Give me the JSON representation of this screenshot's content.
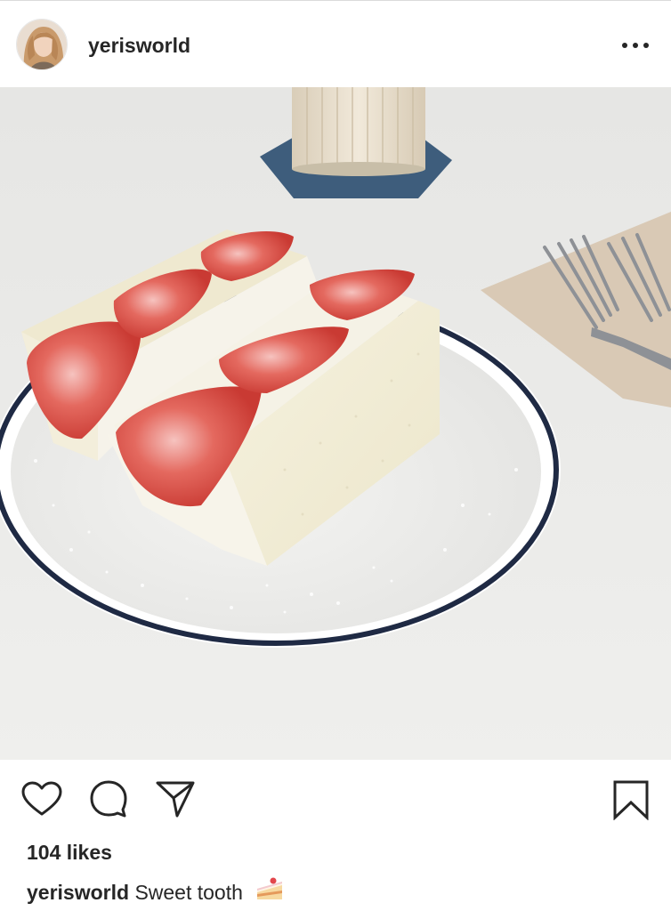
{
  "post": {
    "username": "yerisworld",
    "likes": "104 likes",
    "caption_user": "yerisworld",
    "caption_text": "Sweet tooth",
    "caption_emoji": "cake-slice-icon"
  },
  "icons": {
    "more": "more-options-icon",
    "like": "heart-icon",
    "comment": "comment-icon",
    "share": "share-icon",
    "save": "bookmark-icon"
  },
  "colors": {
    "text": "#262626",
    "divider": "#dbdbdb"
  }
}
